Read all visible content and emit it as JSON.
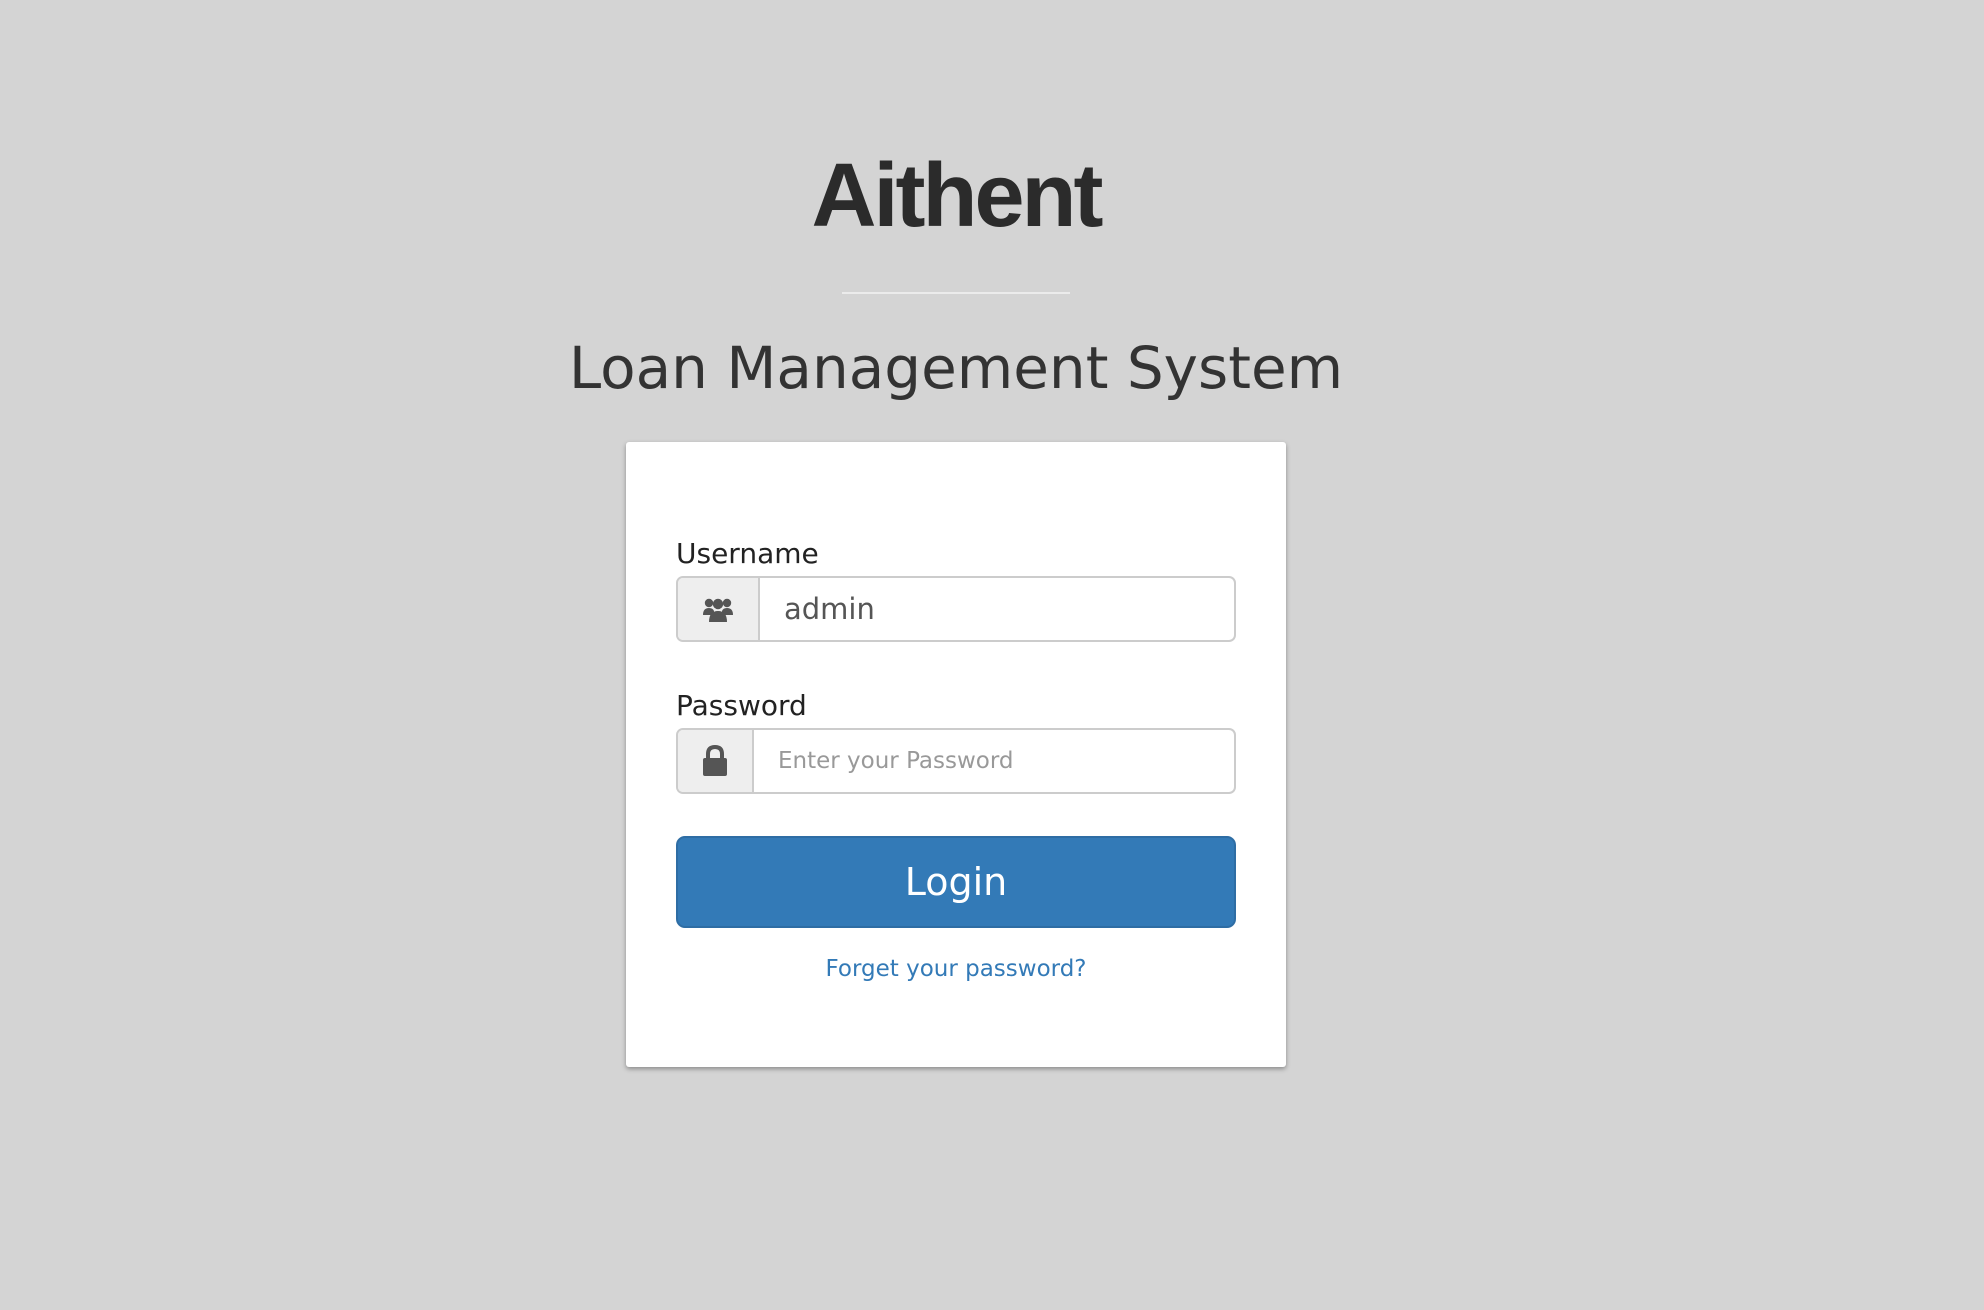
{
  "brand": {
    "name": "Aithent"
  },
  "header": {
    "subtitle": "Loan Management System"
  },
  "login_form": {
    "username": {
      "label": "Username",
      "value": "admin",
      "icon": "users-icon"
    },
    "password": {
      "label": "Password",
      "value": "",
      "placeholder": "Enter your Password",
      "icon": "lock-icon"
    },
    "login_button_label": "Login",
    "forgot_password_link": "Forget your password?"
  },
  "colors": {
    "background": "#d4d4d4",
    "primary": "#337ab7",
    "brand_text": "#2b2b2b"
  }
}
